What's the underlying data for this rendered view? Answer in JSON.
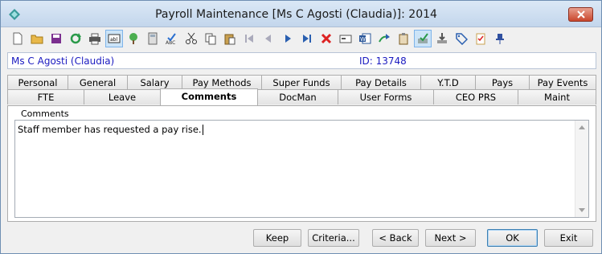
{
  "window": {
    "title": "Payroll Maintenance  [Ms C Agosti (Claudia)]:  2014"
  },
  "toolbar": {
    "icons": [
      "new-icon",
      "open-folder-icon",
      "save-icon",
      "refresh-icon",
      "print-icon",
      "text-field-icon",
      "tree-icon",
      "calculator-icon",
      "spellcheck-icon",
      "cut-icon",
      "copy-icon",
      "paste-icon",
      "first-record-icon",
      "previous-record-icon",
      "next-record-icon",
      "last-record-icon",
      "delete-icon",
      "card-icon",
      "word-icon",
      "arrow-forward-icon",
      "clipboard-icon",
      "approve-icon",
      "download-tray-icon",
      "tag-icon",
      "checklist-icon",
      "pin-icon"
    ]
  },
  "employee": {
    "name": "Ms C Agosti (Claudia)",
    "id_text": "ID: 13748"
  },
  "tabs": {
    "row1": [
      "Personal",
      "General",
      "Salary",
      "Pay Methods",
      "Super Funds",
      "Pay Details",
      "Y.T.D",
      "Pays",
      "Pay Events"
    ],
    "row2": [
      "FTE",
      "Leave",
      "Comments",
      "DocMan",
      "User Forms",
      "CEO PRS",
      "Maint"
    ],
    "selected": "Comments"
  },
  "comments": {
    "label": "Comments",
    "text": "Staff member has requested a pay rise."
  },
  "buttons": {
    "keep": "Keep",
    "criteria": "Criteria...",
    "back": "< Back",
    "next": "Next >",
    "ok": "OK",
    "exit": "Exit"
  },
  "colors": {
    "accent_text": "#1a1ac0",
    "close_button": "#c9462c",
    "titlebar": "#c3d6ec"
  }
}
